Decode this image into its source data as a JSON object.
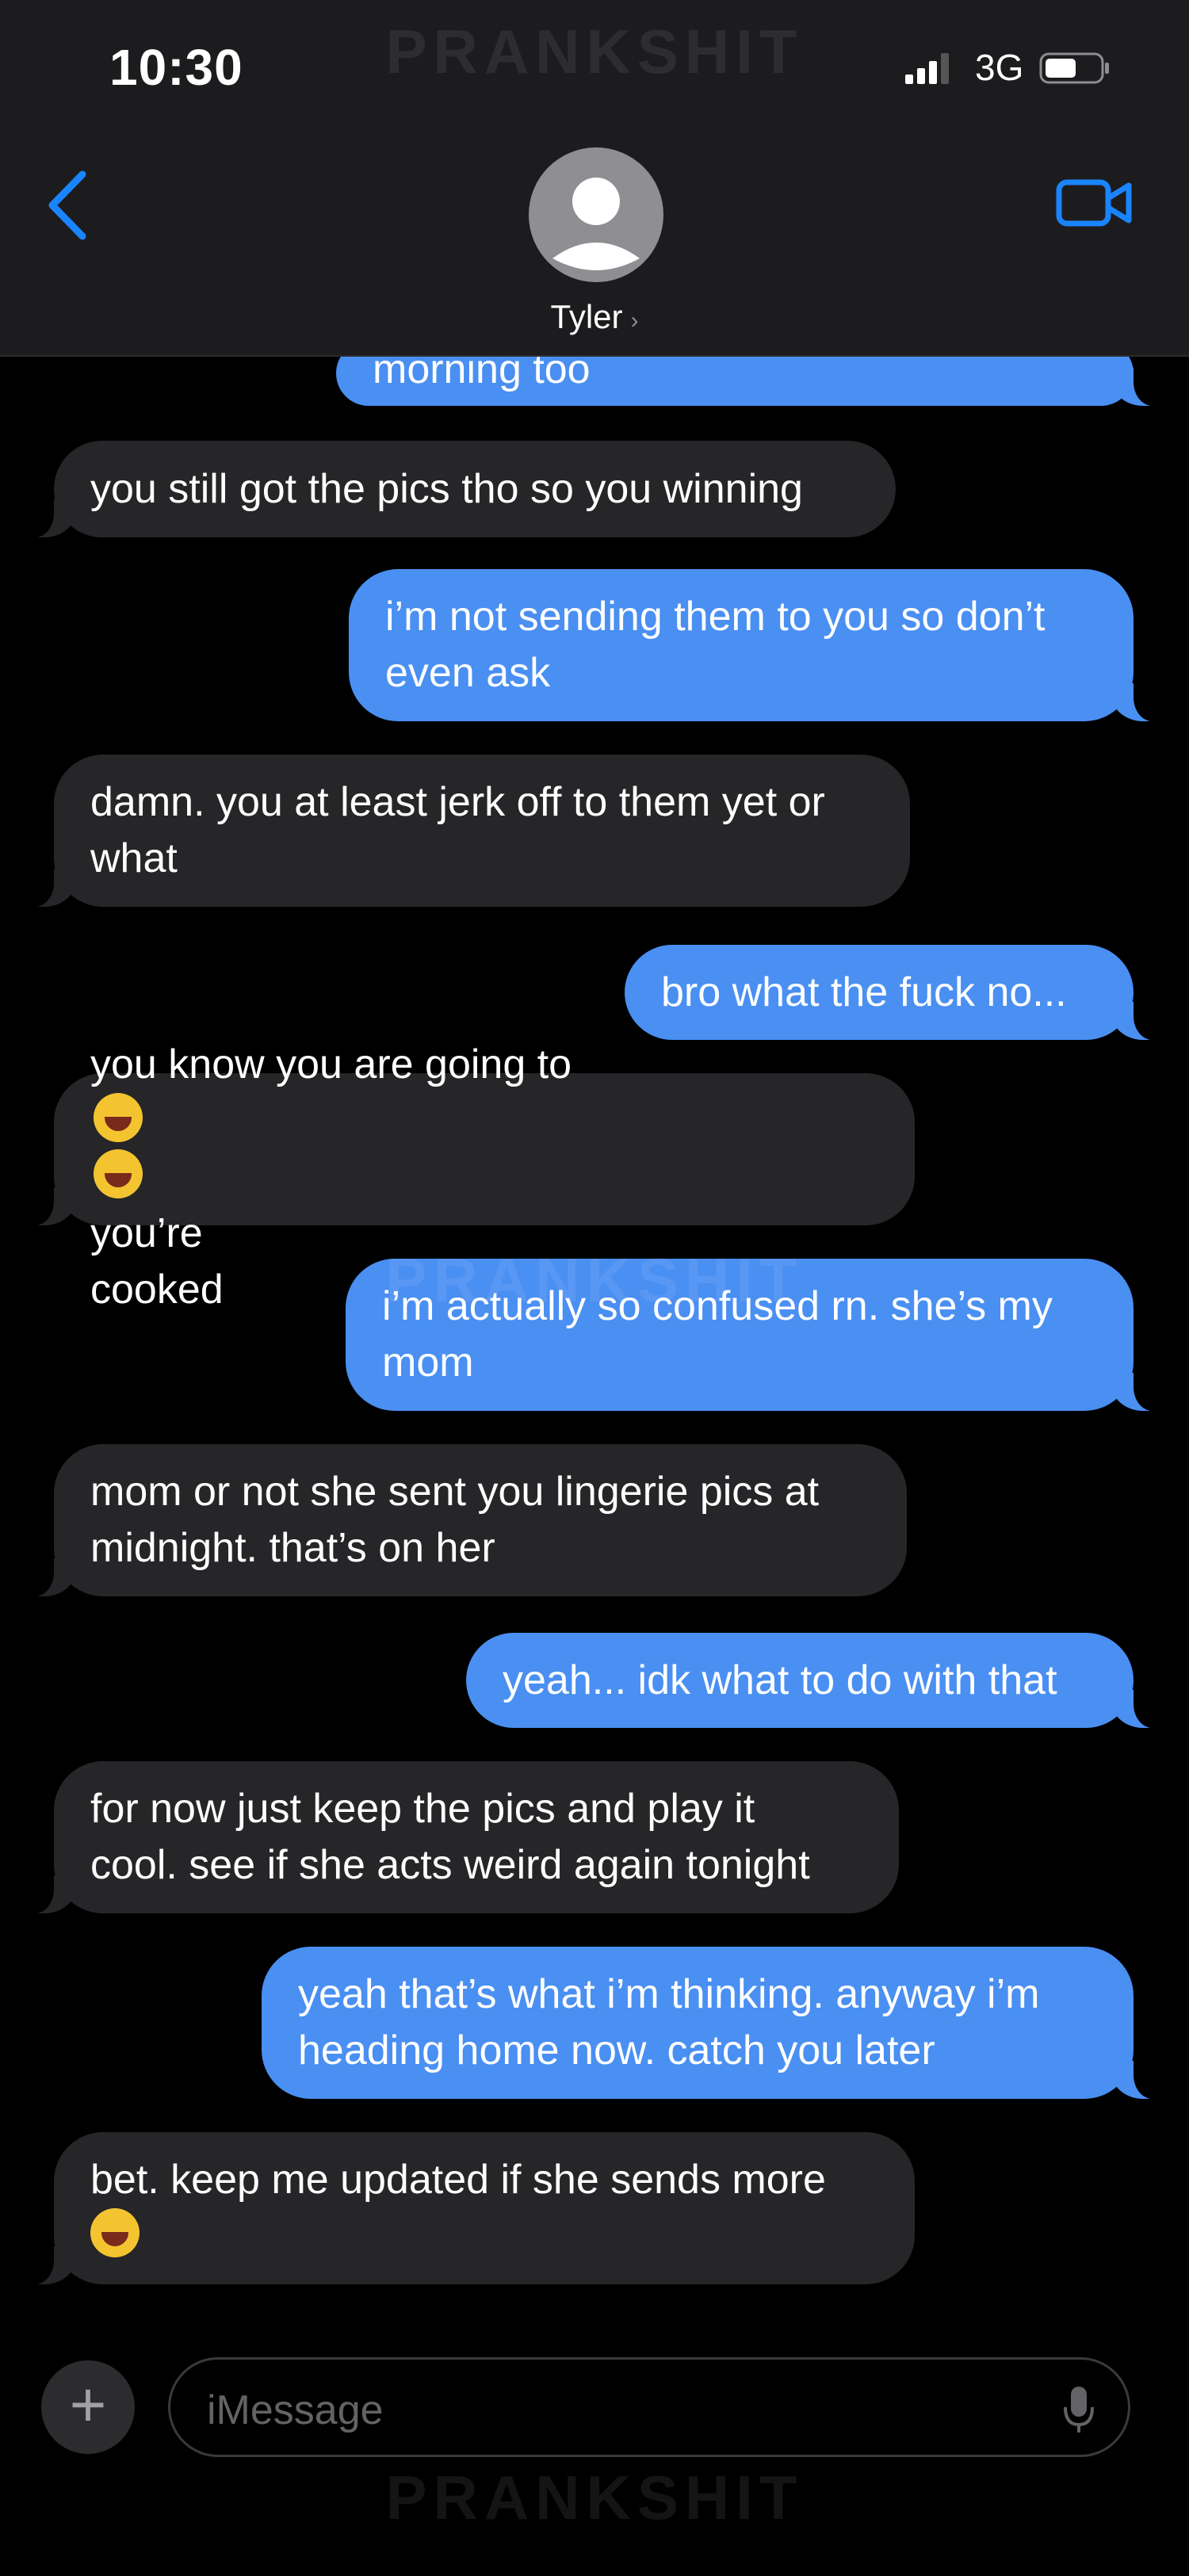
{
  "status_bar": {
    "time": "10:30",
    "carrier": "3G"
  },
  "header": {
    "contact_name": "Tyler",
    "back_icon": "chevron-left-icon",
    "video_icon": "video-camera-icon"
  },
  "watermark": {
    "text": "PRANKSHIT"
  },
  "messages": [
    {
      "from": "me",
      "text": "morning too"
    },
    {
      "from": "them",
      "text": "you still got the pics tho so you winning"
    },
    {
      "from": "me",
      "text": "i’m not sending them to you so don’t\neven ask"
    },
    {
      "from": "them",
      "text": "damn. you at least jerk off to them yet or\nwhat"
    },
    {
      "from": "me",
      "text": "bro what the fuck no..."
    },
    {
      "from": "them",
      "text_before": "you know you are going to",
      "emoji": "😂",
      "text_after": "you’re",
      "text_line2": "cooked"
    },
    {
      "from": "me",
      "text": "i’m actually so confused rn. she’s my\nmom"
    },
    {
      "from": "them",
      "text": "mom or not she sent you lingerie pics at\nmidnight. that’s on her"
    },
    {
      "from": "me",
      "text": "yeah... idk what to do with that"
    },
    {
      "from": "them",
      "text": "for now just keep the pics and play it\ncool. see if she acts weird again tonight"
    },
    {
      "from": "me",
      "text": "yeah that’s what i’m thinking. anyway i’m\nheading home now. catch you later"
    },
    {
      "from": "them",
      "text": "bet. keep me updated if she sends more",
      "emoji": "😂"
    }
  ],
  "composer": {
    "placeholder": "iMessage",
    "plus_icon": "plus-icon",
    "mic_icon": "microphone-icon"
  },
  "colors": {
    "incoming": "#262628",
    "outgoing": "#4a8ff2",
    "accent": "#1a84ff",
    "header_bg": "#1c1c1e"
  }
}
